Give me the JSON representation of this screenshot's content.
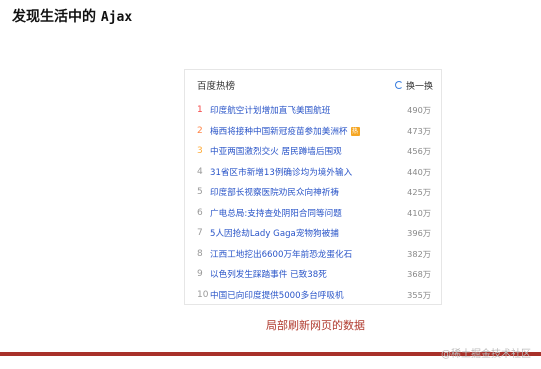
{
  "page": {
    "title_prefix": "发现生活中的 ",
    "title_mono": "Ajax",
    "caption": "局部刷新网页的数据",
    "watermark": "@稀土掘金技术社区"
  },
  "hotlist": {
    "title": "百度热榜",
    "refresh_label": "换一换",
    "items": [
      {
        "rank": "1",
        "title": "印度航空计划增加直飞美国航班",
        "count": "490万"
      },
      {
        "rank": "2",
        "title": "梅西将接种中国新冠疫苗参加美洲杯",
        "count": "473万",
        "badge": "热"
      },
      {
        "rank": "3",
        "title": "中亚两国激烈交火 居民蹲墙后围观",
        "count": "456万"
      },
      {
        "rank": "4",
        "title": "31省区市新增13例确诊均为境外输入",
        "count": "440万"
      },
      {
        "rank": "5",
        "title": "印度部长视察医院劝民众向神祈祷",
        "count": "425万"
      },
      {
        "rank": "6",
        "title": "广电总局:支持查处阴阳合同等问题",
        "count": "410万"
      },
      {
        "rank": "7",
        "title": "5人因抢劫Lady Gaga宠物狗被捕",
        "count": "396万"
      },
      {
        "rank": "8",
        "title": "江西工地挖出6600万年前恐龙蛋化石",
        "count": "382万"
      },
      {
        "rank": "9",
        "title": "以色列发生踩踏事件 已致38死",
        "count": "368万"
      },
      {
        "rank": "10",
        "title": "中国已向印度提供5000多台呼吸机",
        "count": "355万"
      }
    ]
  }
}
